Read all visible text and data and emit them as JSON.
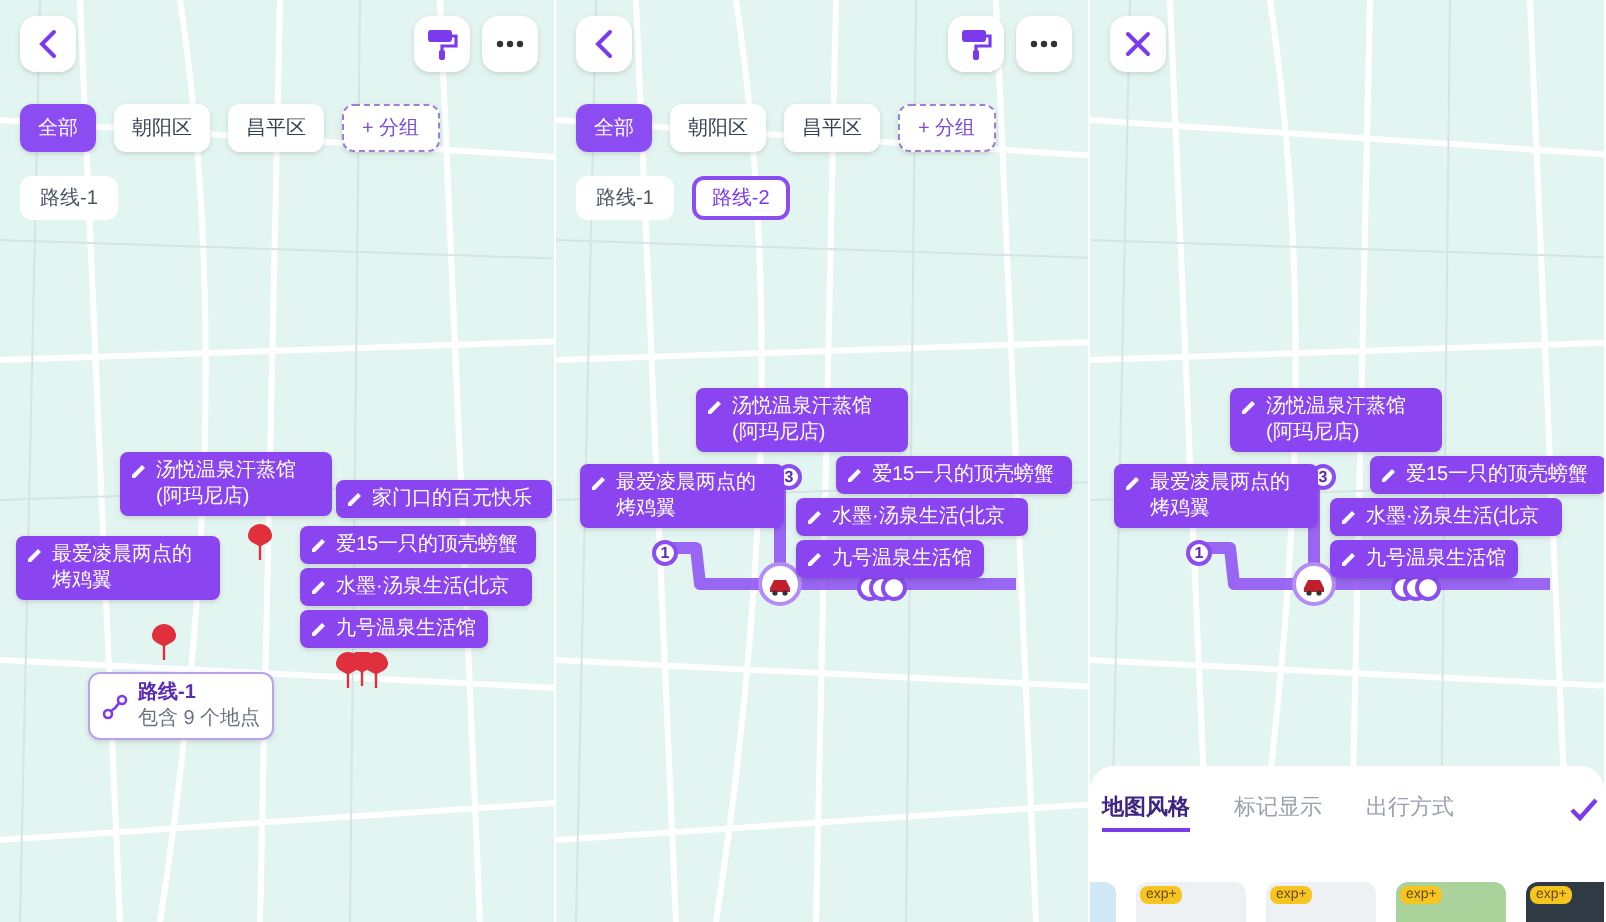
{
  "panels": [
    {
      "nav": {
        "kind": "back"
      },
      "tools": true,
      "kind": "pins",
      "filters": [
        {
          "label": "全部",
          "kind": "chip",
          "selected": true
        },
        {
          "label": "朝阳区",
          "kind": "chip",
          "selected": false
        },
        {
          "label": "昌平区",
          "kind": "chip",
          "selected": false
        },
        {
          "label": "+ 分组",
          "kind": "add"
        }
      ],
      "routes": [
        {
          "label": "路线-1",
          "selected": false
        }
      ],
      "callouts": [
        "汤悦温泉汗蒸馆(阿玛尼店)",
        "家门口的百元快乐",
        "最爱凌晨两点的烤鸡翼",
        "爱15一只的顶壳螃蟹",
        "水墨·汤泉生活(北京",
        "九号温泉生活馆"
      ],
      "route_card": {
        "title": "路线-1",
        "subtitle": "包含 9 个地点"
      }
    },
    {
      "nav": {
        "kind": "back"
      },
      "tools": true,
      "kind": "route",
      "filters": [
        {
          "label": "全部",
          "kind": "chip",
          "selected": true
        },
        {
          "label": "朝阳区",
          "kind": "chip",
          "selected": false
        },
        {
          "label": "昌平区",
          "kind": "chip",
          "selected": false
        },
        {
          "label": "+ 分组",
          "kind": "add"
        }
      ],
      "routes": [
        {
          "label": "路线-1",
          "selected": false
        },
        {
          "label": "路线-2",
          "selected": true
        }
      ],
      "callouts": [
        "汤悦温泉汗蒸馆(阿玛尼店)",
        "最爱凌晨两点的烤鸡翼",
        "爱15一只的顶壳螃蟹",
        "水墨·汤泉生活(北京",
        "九号温泉生活馆"
      ],
      "route_markers": [
        "1",
        "3"
      ]
    },
    {
      "nav": {
        "kind": "close"
      },
      "tools": false,
      "kind": "route",
      "callouts": [
        "汤悦温泉汗蒸馆(阿玛尼店)",
        "最爱凌晨两点的烤鸡翼",
        "爱15一只的顶壳螃蟹",
        "水墨·汤泉生活(北京",
        "九号温泉生活馆"
      ],
      "route_markers": [
        "1",
        "3"
      ],
      "sheet": {
        "tabs": [
          {
            "label": "地图风格",
            "selected": true
          },
          {
            "label": "标记显示",
            "selected": false
          },
          {
            "label": "出行方式",
            "selected": false
          }
        ],
        "thumbnails": [
          {
            "badge": "exp+"
          },
          {
            "badge": "exp+"
          },
          {
            "badge": "exp+"
          },
          {
            "badge": "exp+"
          }
        ]
      }
    }
  ]
}
